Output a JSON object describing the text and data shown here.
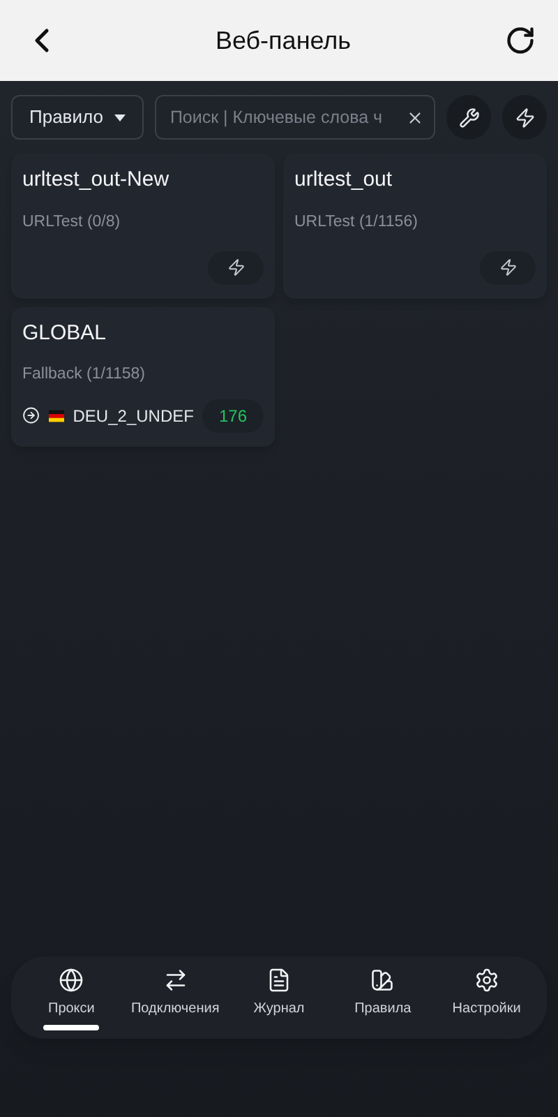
{
  "header": {
    "title": "Веб-панель"
  },
  "toolbar": {
    "mode": "Правило",
    "search": {
      "placeholder": "Поиск | Ключевые слова ч"
    }
  },
  "groups": [
    {
      "name": "urltest_out-New",
      "type": "URLTest (0/8)",
      "footer": {
        "kind": "test"
      }
    },
    {
      "name": "urltest_out",
      "type": "URLTest (1/1156)",
      "footer": {
        "kind": "test"
      }
    },
    {
      "name": "GLOBAL",
      "type": "Fallback (1/1158)",
      "footer": {
        "kind": "selected",
        "proxy": "DEU_2_UNDEF",
        "latency": "176"
      }
    }
  ],
  "nav": [
    {
      "label": "Прокси",
      "selected": true
    },
    {
      "label": "Подключения",
      "selected": false
    },
    {
      "label": "Журнал",
      "selected": false
    },
    {
      "label": "Правила",
      "selected": false
    },
    {
      "label": "Настройки",
      "selected": false
    }
  ]
}
